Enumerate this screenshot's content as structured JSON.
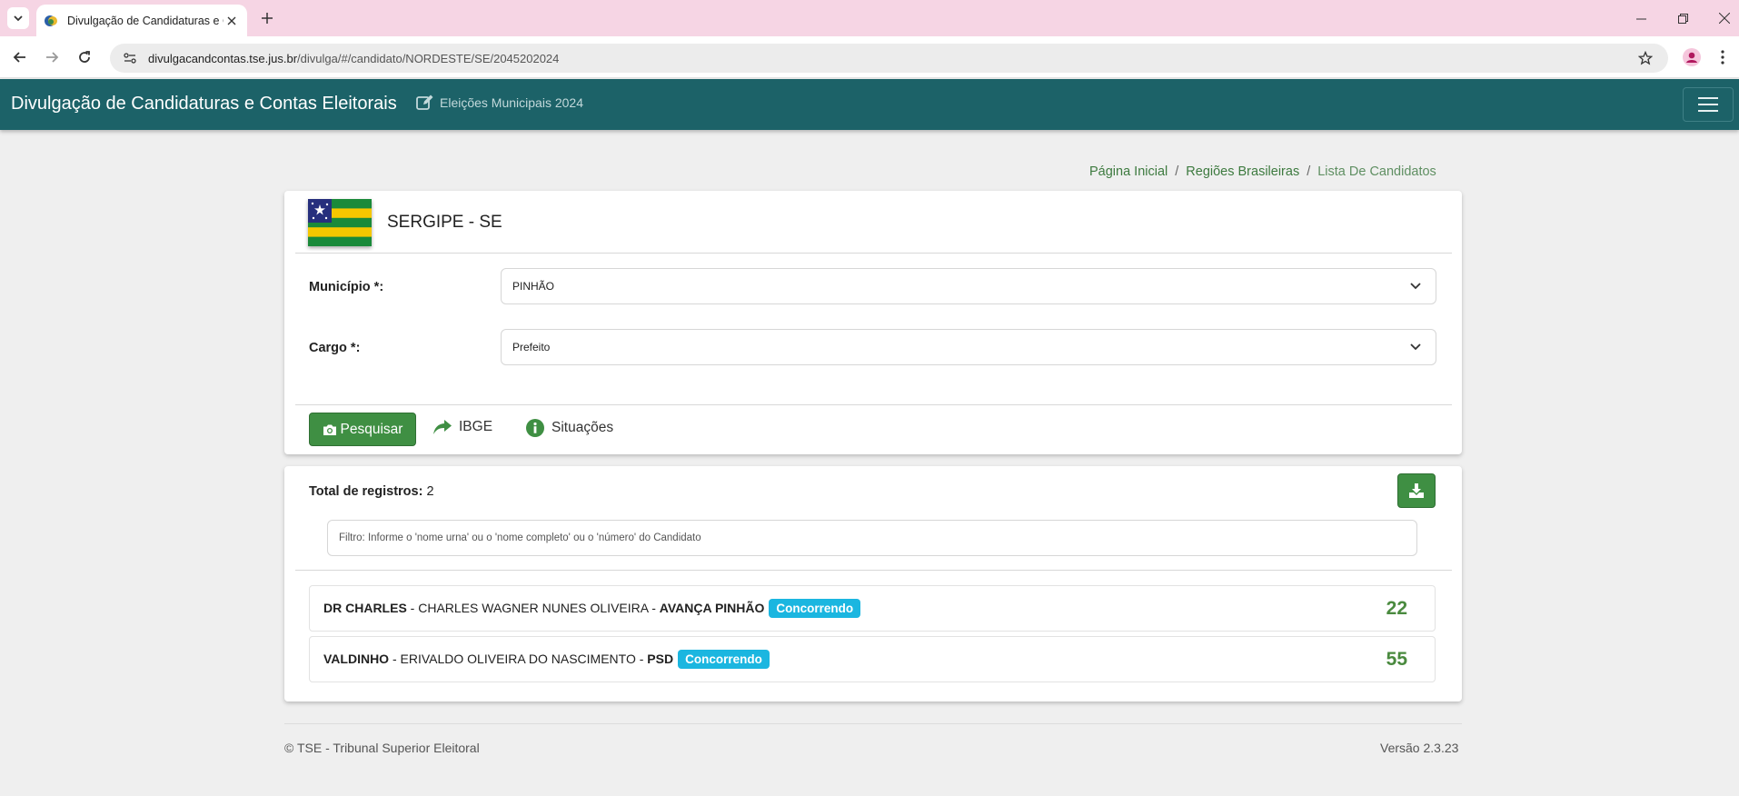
{
  "browser": {
    "tab_title": "Divulgação de Candidaturas e C",
    "url_host": "divulgacandcontas.tse.jus.br",
    "url_path": "/divulga/#/candidato/NORDESTE/SE/2045202024"
  },
  "header": {
    "title": "Divulgação de Candidaturas e Contas Eleitorais",
    "subtitle": "Eleições Municipais 2024",
    "color": "#1c6268"
  },
  "breadcrumb": {
    "items": [
      "Página Inicial",
      "Regiões Brasileiras",
      "Lista De Candidatos"
    ],
    "separator": "/"
  },
  "state": {
    "name": "SERGIPE - SE"
  },
  "form": {
    "municipio_label": "Município *:",
    "municipio_value": "PINHÃO",
    "cargo_label": "Cargo *:",
    "cargo_value": "Prefeito"
  },
  "actions": {
    "pesquisar": "Pesquisar",
    "ibge": "IBGE",
    "situacoes": "Situações"
  },
  "results": {
    "total_label": "Total de registros:",
    "total_value": "2",
    "filter_placeholder": "Filtro: Informe o 'nome urna' ou o 'nome completo' ou o 'número' do Candidato",
    "candidates": [
      {
        "nome_urna": "DR CHARLES",
        "nome_completo": " - CHARLES WAGNER NUNES OLIVEIRA - ",
        "partido": "AVANÇA PINHÃO",
        "situacao": "Concorrendo",
        "numero": "22"
      },
      {
        "nome_urna": "VALDINHO",
        "nome_completo": " - ERIVALDO OLIVEIRA DO NASCIMENTO - ",
        "partido": "PSD",
        "situacao": "Concorrendo",
        "numero": "55"
      }
    ]
  },
  "footer": {
    "copyright": "© TSE - Tribunal Superior Eleitoral",
    "version": "Versão 2.3.23"
  },
  "colors": {
    "primary_green": "#3f8f43",
    "badge_cyan": "#1bb6e0",
    "number_green": "#4a8a3f"
  }
}
